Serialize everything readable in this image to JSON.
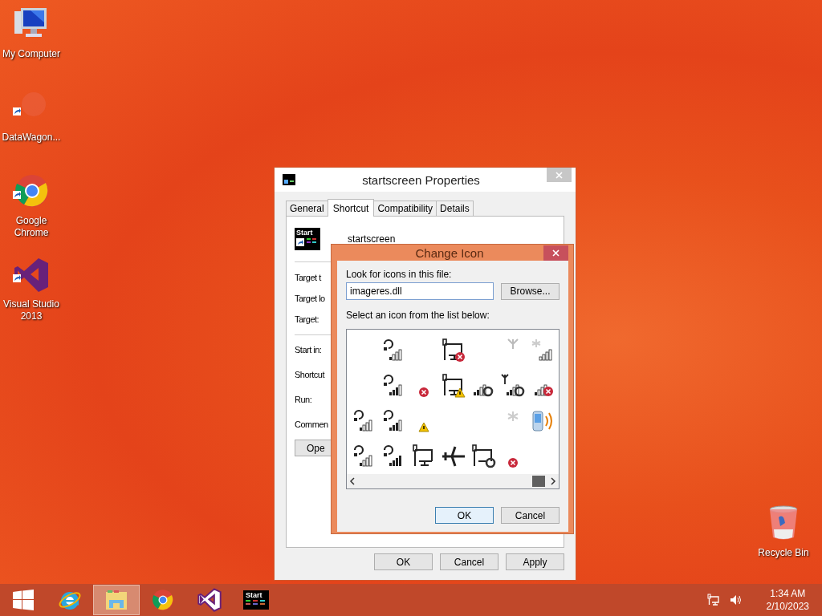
{
  "desktop_icons": [
    {
      "kind": "computer",
      "label": "My Computer"
    },
    {
      "kind": "faded",
      "label": "DataWagon..."
    },
    {
      "kind": "chrome",
      "label": "Google Chrome"
    },
    {
      "kind": "visual-studio",
      "label": "Visual Studio 2013"
    }
  ],
  "recycle_bin": {
    "label": "Recycle Bin"
  },
  "properties_window": {
    "title": "startscreen Properties",
    "tabs": [
      {
        "label": "General",
        "selected": false
      },
      {
        "label": "Shortcut",
        "selected": true
      },
      {
        "label": "Compatibility",
        "selected": false
      },
      {
        "label": "Details",
        "selected": false
      }
    ],
    "app_icon_text": "Start",
    "app_name": "startscreen",
    "fields": [
      "Target t",
      "Target lo",
      "Target:",
      "Start in:",
      "Shortcut",
      "Run:",
      "Commen"
    ],
    "open_button": "Ope",
    "buttons": [
      "OK",
      "Cancel",
      "Apply"
    ]
  },
  "change_icon_dialog": {
    "title": "Change Icon",
    "file_label": "Look for icons in this file:",
    "file_value": "imageres.dll",
    "browse_button": "Browse...",
    "list_label": "Select an icon from the list below:",
    "buttons": [
      "OK",
      "Cancel"
    ]
  },
  "taskbar": {
    "items": [
      {
        "kind": "start",
        "selected": false
      },
      {
        "kind": "ie",
        "selected": false
      },
      {
        "kind": "explorer",
        "selected": true
      },
      {
        "kind": "chrome",
        "selected": false
      },
      {
        "kind": "visual-studio",
        "selected": false
      },
      {
        "kind": "startscreen",
        "selected": false,
        "text": "Start"
      }
    ],
    "time": "1:34 AM",
    "date": "2/10/2023"
  }
}
